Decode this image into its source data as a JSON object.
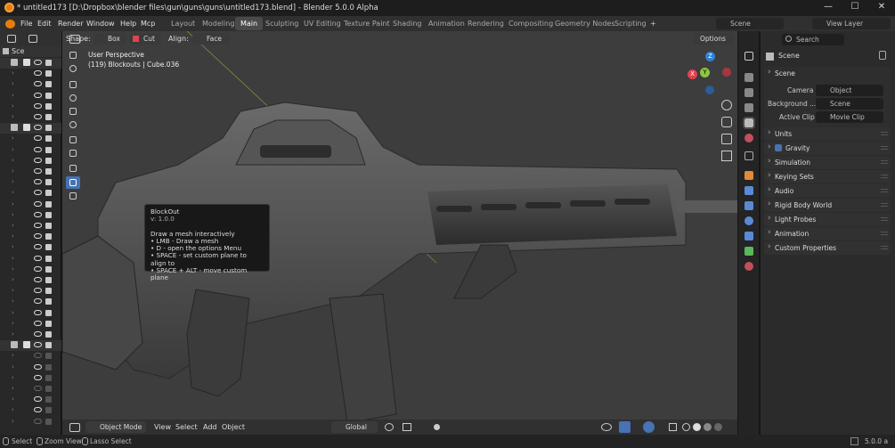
{
  "window": {
    "title": "* untitled173 [D:\\Dropbox\\blender files\\gun\\guns\\guns\\untitled173.blend] - Blender 5.0.0 Alpha",
    "minimize": "—",
    "maximize": "☐",
    "close": "✕"
  },
  "menubar": {
    "items": [
      "File",
      "Edit",
      "Render",
      "Window",
      "Help",
      "Mcp"
    ],
    "workspaces": [
      "Layout",
      "Modeling",
      "Main",
      "Sculpting",
      "UV Editing",
      "Texture Paint",
      "Shading",
      "Animation",
      "Rendering",
      "Compositing",
      "Geometry Nodes",
      "Scripting"
    ],
    "active_workspace": "Main",
    "add_tab": "+",
    "scene_label": "Scene",
    "view_layer_label": "View Layer"
  },
  "outliner": {
    "header_label": "Sce"
  },
  "viewport": {
    "shape_label": "Shape:",
    "shape_value": "Box",
    "cut_value": "Cut",
    "align_label": "Align:",
    "align_value": "Face",
    "options_label": "Options",
    "perspective_text": "User Perspective",
    "object_text": "(119) Blockouts | Cube.036",
    "gizmo_z": "Z",
    "gizmo_y": "Y",
    "gizmo_x": "X",
    "mode_label": "Object Mode",
    "view_menu": "View",
    "select_menu": "Select",
    "add_menu": "Add",
    "object_menu": "Object",
    "transform_orientation": "Global"
  },
  "tooltip": {
    "title": "BlockOut",
    "version": "v: 1.0.0",
    "description": "Draw a mesh interactively",
    "lines": [
      "• LMB - Draw a mesh",
      "• D - open the options Menu",
      "• SPACE - set custom plane to align to",
      "• SPACE + ALT - move custom plane"
    ]
  },
  "properties": {
    "search_placeholder": "Search",
    "context_title": "Scene",
    "section_scene": "Scene",
    "camera_label": "Camera",
    "camera_placeholder": "Object",
    "background_label": "Background ...",
    "background_placeholder": "Scene",
    "active_clip_label": "Active Clip",
    "active_clip_placeholder": "Movie Clip",
    "panels": [
      "Units",
      "Gravity",
      "Simulation",
      "Keying Sets",
      "Audio",
      "Rigid Body World",
      "Light Probes",
      "Animation",
      "Custom Properties"
    ]
  },
  "statusbar": {
    "select": "Select",
    "zoom_view": "Zoom View",
    "lasso_select": "Lasso Select",
    "version": "5.0.0 a"
  },
  "colors": {
    "accent": "#4772b3",
    "x_axis": "#e0424f",
    "y_axis": "#8cc63f",
    "z_axis": "#2f80d6"
  }
}
